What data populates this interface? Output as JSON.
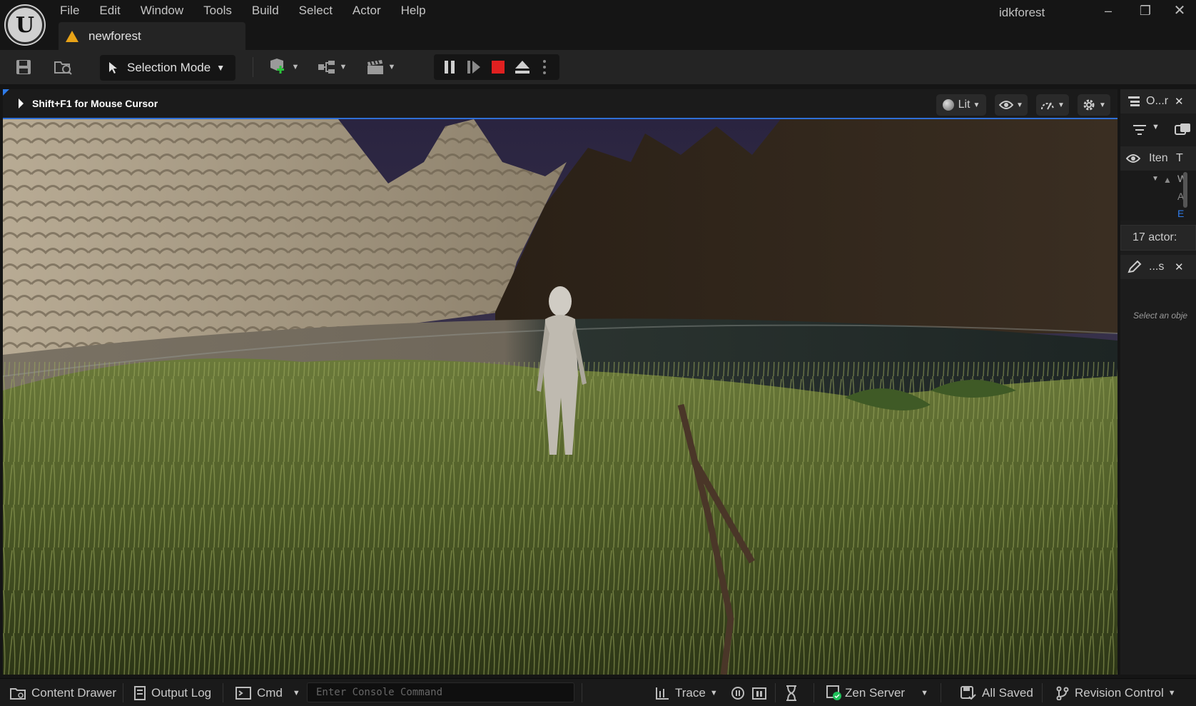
{
  "app": {
    "logo_letter": "U",
    "project_name": "idkforest"
  },
  "menu": [
    "File",
    "Edit",
    "Window",
    "Tools",
    "Build",
    "Select",
    "Actor",
    "Help"
  ],
  "document_tab": {
    "name": "newforest",
    "icon": "warning-icon"
  },
  "window_controls": {
    "minimize": "–",
    "restore": "❐",
    "close": "✕"
  },
  "toolbar": {
    "save_icon": "save-icon",
    "browse_icon": "content-browse-icon",
    "selection_mode_label": "Selection Mode",
    "add_actor_icon": "add-actor-icon",
    "blueprint_icon": "blueprint-icon",
    "cinematics_icon": "clapperboard-icon",
    "play_controls": [
      "pause-icon",
      "step-frame-icon",
      "stop-icon",
      "eject-icon",
      "more-options-icon"
    ]
  },
  "viewport": {
    "hint": "Shift+F1 for Mouse Cursor",
    "view_mode_label": "Lit",
    "show_icon": "eye-icon",
    "realtime_icon": "performance-icon",
    "settings_icon": "gear-icon"
  },
  "outliner": {
    "tab_label": "O...r",
    "tab_close": "✕",
    "column_item": "Iten",
    "column_type": "T",
    "tree_row_1": "W",
    "tree_row_2": "A",
    "tree_row_3": "E",
    "actor_count": "17 actor:"
  },
  "details": {
    "tab_label": "...s",
    "tab_close": "✕",
    "placeholder": "Select an obje"
  },
  "statusbar": {
    "content_drawer": "Content Drawer",
    "output_log": "Output Log",
    "cmd": "Cmd",
    "console_placeholder": "Enter Console Command",
    "trace": "Trace",
    "zen_server": "Zen Server",
    "all_saved": "All Saved",
    "revision_control": "Revision Control"
  },
  "colors": {
    "accent": "#2f7be8",
    "stop": "#e02020",
    "warning": "#e8a317",
    "zen_ok": "#1ec05a"
  }
}
